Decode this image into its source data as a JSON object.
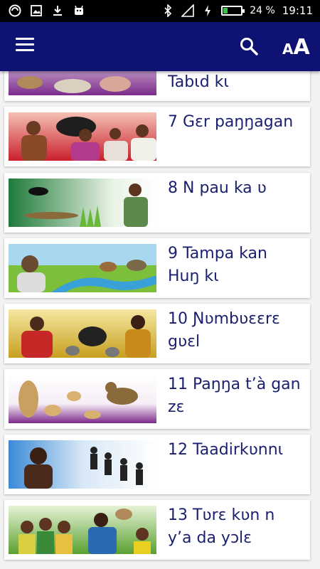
{
  "status_bar": {
    "battery": "24 %",
    "time": "19:11",
    "battery_level": 0.24
  },
  "app_bar": {
    "menu_icon": "hamburger-menu-icon",
    "search_icon": "search-icon",
    "font_size_icon": "font-size-icon",
    "font_small_letter": "A",
    "font_big_letter": "A",
    "background_color": "#0d1273"
  },
  "lessons": [
    {
      "title": "Tabɩd kɩ"
    },
    {
      "title": "7 Gɛr paŋŋagan"
    },
    {
      "title": "8 N pau ka ʋ"
    },
    {
      "title": "9 Tampa kan Huŋ kɩ"
    },
    {
      "title": "10 Ɲʋmbʋɛɛrɛ gʋɛl"
    },
    {
      "title": "11 Paŋŋa t’à gan zɛ"
    },
    {
      "title": "12 Taadirkʋnnɩ"
    },
    {
      "title": "13 Tʋrɛ kʋn n y’a da yɔlɛ"
    }
  ],
  "colors": {
    "title_text": "#1a1f6e",
    "card_bg": "#ffffff",
    "list_bg": "#f2f2f2"
  }
}
